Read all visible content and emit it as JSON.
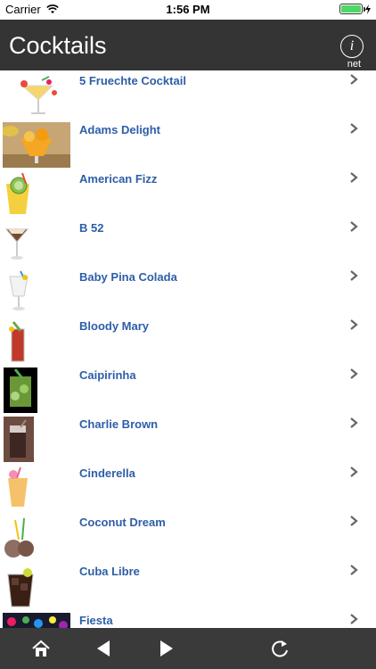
{
  "status_bar": {
    "carrier": "Carrier",
    "time": "1:56 PM",
    "battery_percent": 100,
    "battery_color": "#4cd964"
  },
  "navbar": {
    "title": "Cocktails",
    "info_icon": "info-icon",
    "info_label": "net",
    "bg_color": "#343434"
  },
  "list": {
    "text_color": "#2d5ea8",
    "items": [
      {
        "name": "5 Fruechte Cocktail",
        "thumb": "martini-glass-fruit"
      },
      {
        "name": "Adams Delight",
        "thumb": "fruit-bowl"
      },
      {
        "name": "American Fizz",
        "thumb": "yellow-drink-lime"
      },
      {
        "name": "B 52",
        "thumb": "cocktail-glass"
      },
      {
        "name": "Baby Pina Colada",
        "thumb": "pina-colada-glass"
      },
      {
        "name": "Bloody Mary",
        "thumb": "tall-red-glass"
      },
      {
        "name": "Caipirinha",
        "thumb": "lime-glass"
      },
      {
        "name": "Charlie Brown",
        "thumb": "coffee-drink"
      },
      {
        "name": "Cinderella",
        "thumb": "orange-drink"
      },
      {
        "name": "Coconut Dream",
        "thumb": "coconut"
      },
      {
        "name": "Cuba Libre",
        "thumb": "cola-glass"
      },
      {
        "name": "Fiesta",
        "thumb": "party-lights"
      }
    ]
  },
  "toolbar": {
    "items": [
      "home-icon",
      "back-arrow-icon",
      "forward-arrow-icon",
      "refresh-icon"
    ]
  }
}
